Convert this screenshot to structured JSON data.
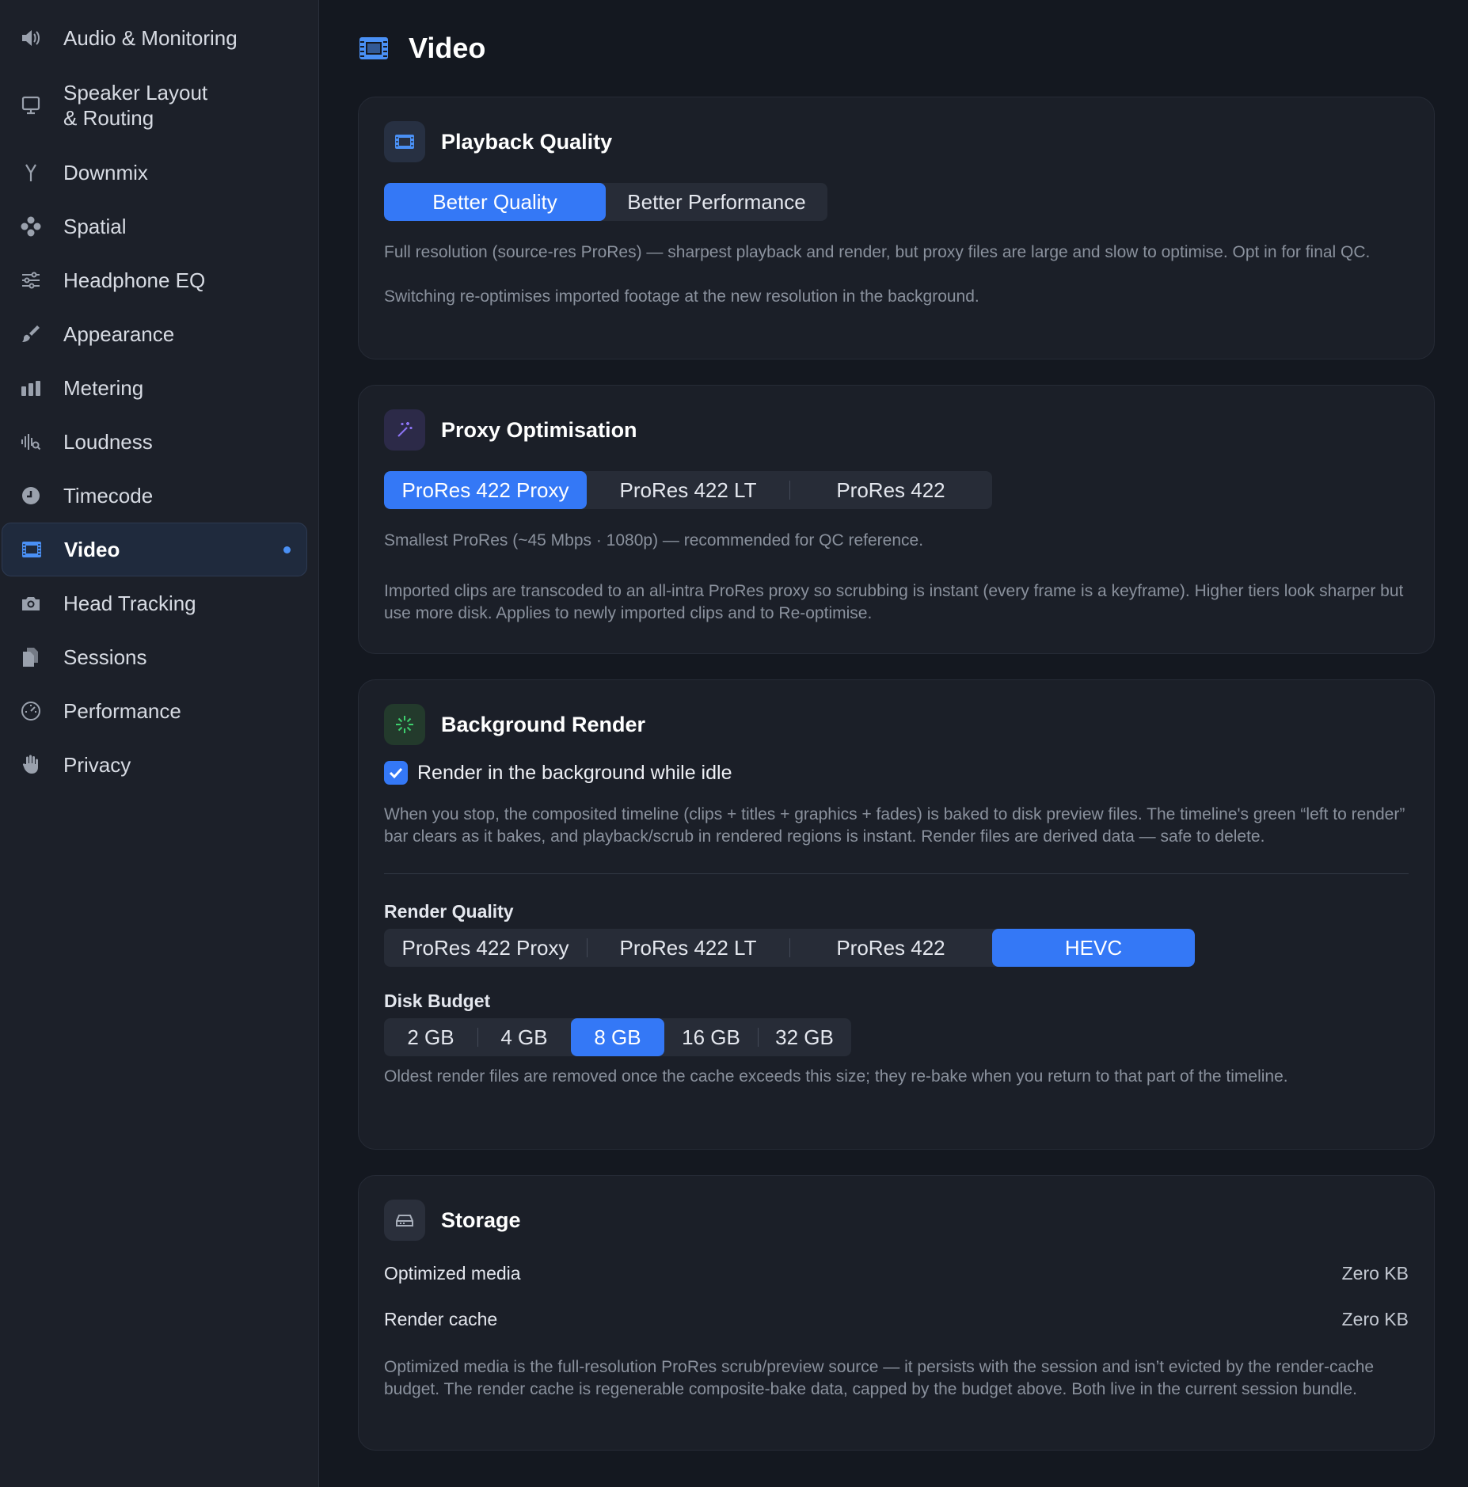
{
  "sidebar": {
    "items": [
      {
        "label": "Audio & Monitoring",
        "icon": "speaker-icon"
      },
      {
        "label": "Speaker Layout\n& Routing",
        "icon": "display-icon"
      },
      {
        "label": "Downmix",
        "icon": "downmix-icon"
      },
      {
        "label": "Spatial",
        "icon": "spatial-icon"
      },
      {
        "label": "Headphone EQ",
        "icon": "sliders-icon"
      },
      {
        "label": "Appearance",
        "icon": "paintbrush-icon"
      },
      {
        "label": "Metering",
        "icon": "meter-bars-icon"
      },
      {
        "label": "Loudness",
        "icon": "waveform-icon"
      },
      {
        "label": "Timecode",
        "icon": "clock-icon"
      },
      {
        "label": "Video",
        "icon": "film-icon",
        "active": true
      },
      {
        "label": "Head Tracking",
        "icon": "camera-icon"
      },
      {
        "label": "Sessions",
        "icon": "documents-icon"
      },
      {
        "label": "Performance",
        "icon": "gauge-icon"
      },
      {
        "label": "Privacy",
        "icon": "hand-icon"
      }
    ]
  },
  "page": {
    "title": "Video",
    "icon": "film-icon"
  },
  "playback": {
    "title": "Playback Quality",
    "options": [
      "Better Quality",
      "Better Performance"
    ],
    "selected": "Better Quality",
    "desc1": "Full resolution (source-res ProRes) — sharpest playback and render, but proxy files are large and slow to optimise. Opt in for final QC.",
    "desc2": "Switching re-optimises imported footage at the new resolution in the background."
  },
  "proxy": {
    "title": "Proxy Optimisation",
    "options": [
      "ProRes 422 Proxy",
      "ProRes 422 LT",
      "ProRes 422"
    ],
    "selected": "ProRes 422 Proxy",
    "desc1": "Smallest ProRes (~45 Mbps · 1080p) — recommended for QC reference.",
    "desc2": "Imported clips are transcoded to an all-intra ProRes proxy so scrubbing is instant (every frame is a keyframe). Higher tiers look sharper but use more disk. Applies to newly imported clips and to Re-optimise."
  },
  "render": {
    "title": "Background Render",
    "checkbox_label": "Render in the background while idle",
    "checked": true,
    "desc": "When you stop, the composited timeline (clips + titles + graphics + fades) is baked to disk preview files. The timeline's green “left to render” bar clears as it bakes, and playback/scrub in rendered regions is instant. Render files are derived data — safe to delete.",
    "quality_label": "Render Quality",
    "quality_options": [
      "ProRes 422 Proxy",
      "ProRes 422 LT",
      "ProRes 422",
      "HEVC"
    ],
    "quality_selected": "HEVC",
    "budget_label": "Disk Budget",
    "budget_options": [
      "2 GB",
      "4 GB",
      "8 GB",
      "16 GB",
      "32 GB"
    ],
    "budget_selected": "8 GB",
    "budget_desc": "Oldest render files are removed once the cache exceeds this size; they re-bake when you return to that part of the timeline."
  },
  "storage": {
    "title": "Storage",
    "rows": [
      {
        "label": "Optimized media",
        "value": "Zero KB"
      },
      {
        "label": "Render cache",
        "value": "Zero KB"
      }
    ],
    "desc": "Optimized media is the full-resolution ProRes scrub/preview source — it persists with the session and isn’t evicted by the render-cache budget. The render cache is regenerable composite-bake data, capped by the budget above. Both live in the current session bundle."
  },
  "colors": {
    "accent": "#3478f6",
    "background": "#141820",
    "sidebar": "#1c2029",
    "card": "#1b1f28"
  }
}
